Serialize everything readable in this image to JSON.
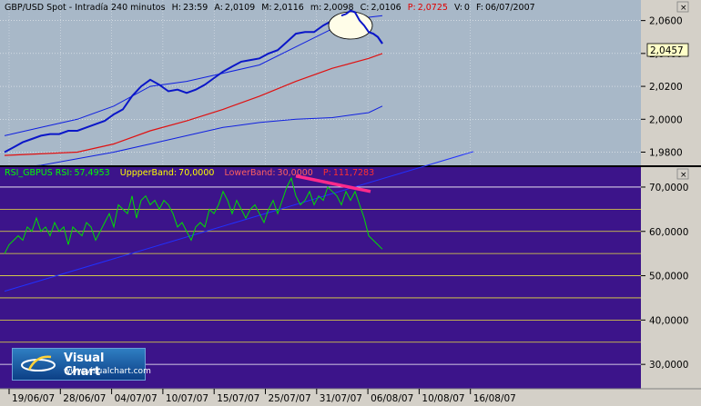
{
  "chart_data": [
    {
      "type": "line",
      "series_label": "GBP/USD Spot - Intradía 240 minutos",
      "stats": {
        "h": "23:59",
        "a": "2,0109",
        "M": "2,0116",
        "m": "2,0098",
        "C": "2,0106",
        "P": "2,0725",
        "V": "0",
        "F": "06/07/2007"
      },
      "stat_labels": {
        "h": "H:",
        "a": "A:",
        "M": "M:",
        "m": "m:",
        "C": "C:",
        "P": "P:",
        "V": "V:",
        "F": "F:"
      },
      "y_ticks": [
        "2,0600",
        "2,0400",
        "2,0200",
        "2,0000",
        "1,9800"
      ],
      "ylim": [
        1.972,
        2.0725
      ],
      "last_value": "2,0457",
      "price": {
        "x": [
          0,
          10,
          20,
          30,
          40,
          50,
          60,
          70,
          80,
          90,
          100,
          110,
          120,
          130,
          140,
          150,
          160,
          170,
          180,
          190,
          200,
          210,
          220,
          230,
          240,
          250,
          260,
          270,
          280,
          290,
          300,
          310,
          320,
          330,
          340,
          350,
          360,
          370,
          375,
          380,
          385,
          390,
          395,
          400,
          405,
          410,
          415
        ],
        "y": [
          1.98,
          1.983,
          1.986,
          1.988,
          1.99,
          1.991,
          1.991,
          1.993,
          1.993,
          1.995,
          1.997,
          1.999,
          2.003,
          2.006,
          2.014,
          2.02,
          2.024,
          2.021,
          2.017,
          2.018,
          2.016,
          2.018,
          2.021,
          2.025,
          2.029,
          2.032,
          2.035,
          2.036,
          2.037,
          2.04,
          2.042,
          2.047,
          2.052,
          2.053,
          2.053,
          2.057,
          2.06,
          2.063,
          2.064,
          2.066,
          2.065,
          2.06,
          2.057,
          2.053,
          2.052,
          2.05,
          2.046
        ]
      },
      "ma": {
        "x": [
          0,
          80,
          120,
          160,
          200,
          240,
          280,
          320,
          360,
          400,
          415
        ],
        "y": [
          1.978,
          1.98,
          1.985,
          1.993,
          1.999,
          2.006,
          2.014,
          2.023,
          2.031,
          2.037,
          2.04
        ]
      },
      "band_upper": {
        "x": [
          0,
          40,
          80,
          120,
          160,
          200,
          240,
          280,
          320,
          360,
          400,
          415
        ],
        "y": [
          1.99,
          1.995,
          2.0,
          2.008,
          2.02,
          2.023,
          2.028,
          2.033,
          2.044,
          2.055,
          2.062,
          2.063
        ]
      },
      "band_lower": {
        "x": [
          0,
          40,
          80,
          120,
          160,
          200,
          240,
          280,
          320,
          360,
          400,
          415
        ],
        "y": [
          1.97,
          1.972,
          1.976,
          1.98,
          1.985,
          1.99,
          1.995,
          1.998,
          2.0,
          2.001,
          2.004,
          2.008
        ]
      }
    },
    {
      "type": "line",
      "legend": [
        {
          "label": "RSI_GBPUS RSI:",
          "value": "57,4953",
          "color": "#00ff00"
        },
        {
          "label": "UppperBand:",
          "value": "70,0000",
          "color": "#ffff00"
        },
        {
          "label": "LowerBand:",
          "value": "30,0000",
          "color": "#ff6060"
        },
        {
          "label": "P:",
          "value": "111,7283",
          "color": "#ff3030"
        }
      ],
      "y_ticks": [
        "70,0000",
        "60,0000",
        "50,0000",
        "40,0000",
        "30,0000"
      ],
      "ylim": [
        24.5,
        74.5
      ],
      "hlines": [
        70,
        65,
        60,
        55,
        50,
        45,
        40,
        35,
        30
      ],
      "rsi": {
        "x": [
          0,
          5,
          10,
          15,
          20,
          25,
          30,
          35,
          40,
          45,
          50,
          55,
          60,
          65,
          70,
          75,
          80,
          85,
          90,
          95,
          100,
          105,
          110,
          115,
          120,
          125,
          130,
          135,
          140,
          145,
          150,
          155,
          160,
          165,
          170,
          175,
          180,
          185,
          190,
          195,
          200,
          205,
          210,
          215,
          220,
          225,
          230,
          235,
          240,
          245,
          250,
          255,
          260,
          265,
          270,
          275,
          280,
          285,
          290,
          295,
          300,
          305,
          310,
          315,
          320,
          325,
          330,
          335,
          340,
          345,
          350,
          355,
          360,
          365,
          370,
          375,
          380,
          385,
          390,
          395,
          400,
          405,
          410,
          415
        ],
        "y": [
          55,
          57,
          58,
          59,
          58,
          61,
          60,
          63,
          60,
          61,
          59,
          62,
          60,
          61,
          57,
          61,
          60,
          59,
          62,
          61,
          58,
          60,
          62,
          64,
          61,
          66,
          65,
          64,
          68,
          63,
          67,
          68,
          66,
          67,
          65,
          67,
          66,
          64,
          61,
          62,
          60,
          58,
          61,
          62,
          61,
          65,
          64,
          66,
          69,
          67,
          64,
          67,
          65,
          63,
          65,
          66,
          64,
          62,
          65,
          67,
          64,
          67,
          70,
          72,
          68,
          66,
          67,
          69,
          66,
          68,
          67,
          70,
          69,
          68,
          66,
          69,
          67,
          69,
          66,
          63,
          59,
          58,
          57,
          56
        ]
      },
      "trendline_blue": {
        "x": [
          0,
          515
        ],
        "y": [
          46.5,
          78.0
        ]
      },
      "divergence": {
        "x": [
          320,
          402
        ],
        "y": [
          72.5,
          69.0
        ]
      }
    }
  ],
  "x_ticks": [
    "19/06/07",
    "28/06/07",
    "04/07/07",
    "10/07/07",
    "15/07/07",
    "25/07/07",
    "31/07/07",
    "06/08/07",
    "10/08/07",
    "16/08/07"
  ],
  "logo": {
    "name": "Visual Chart",
    "url": "www.visualchart.com"
  }
}
